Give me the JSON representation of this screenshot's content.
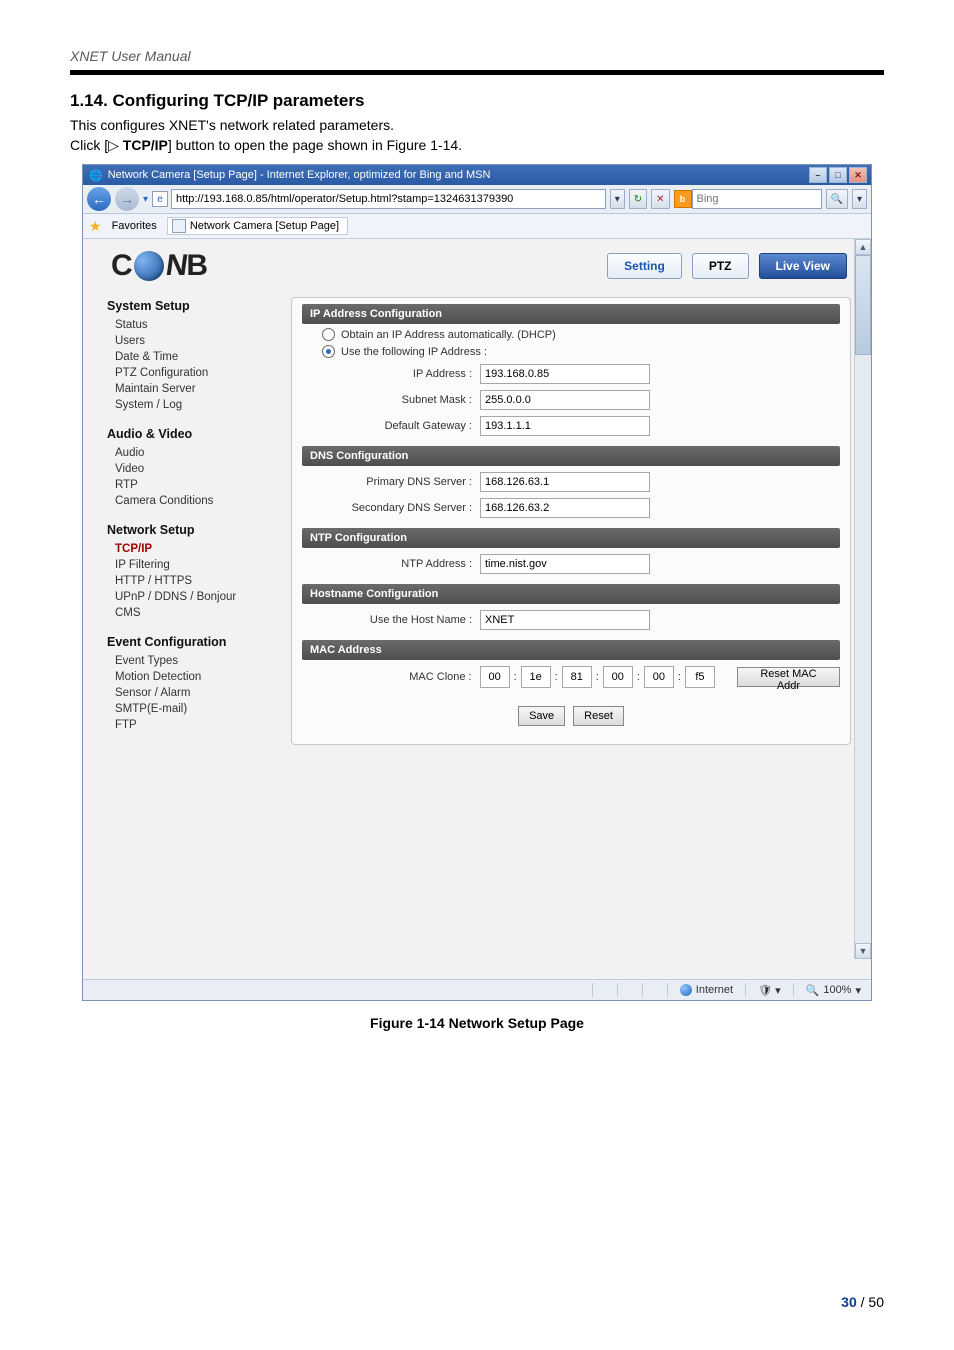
{
  "doc": {
    "running_head": "XNET User Manual",
    "section_title": "1.14. Configuring TCP/IP parameters",
    "body1": "This configures XNET's network related parameters.",
    "body2_pre": "Click [",
    "body2_symbol": "▷ ",
    "body2_btn": "TCP/IP",
    "body2_post": "] button to open the page shown in Figure 1-14.",
    "figure_caption": "Figure 1-14 Network Setup Page",
    "page_cur": "30",
    "page_sep": " / ",
    "page_total": "50"
  },
  "window": {
    "title": "Network Camera [Setup Page] - Internet Explorer, optimized for Bing and MSN",
    "addr": "http://193.168.0.85/html/operator/Setup.html?stamp=1324631379390",
    "search_placeholder": "Bing",
    "fav_label": "Favorites",
    "tab_title": "Network Camera [Setup Page]",
    "status_internet": "Internet",
    "status_zoom": "100%"
  },
  "header_buttons": {
    "setting": "Setting",
    "ptz": "PTZ",
    "live": "Live View"
  },
  "sidebar": {
    "g1": "System Setup",
    "g1_items": [
      "Status",
      "Users",
      "Date & Time",
      "PTZ Configuration",
      "Maintain Server",
      "System / Log"
    ],
    "g2": "Audio & Video",
    "g2_items": [
      "Audio",
      "Video",
      "RTP",
      "Camera Conditions"
    ],
    "g3": "Network Setup",
    "g3_items": [
      "TCP/IP",
      "IP Filtering",
      "HTTP / HTTPS",
      "UPnP / DDNS / Bonjour",
      "CMS"
    ],
    "g4": "Event Configuration",
    "g4_items": [
      "Event Types",
      "Motion Detection",
      "Sensor / Alarm",
      "SMTP(E-mail)",
      "FTP"
    ]
  },
  "panel": {
    "ip_cfg_title": "IP Address Configuration",
    "radio_dhcp": "Obtain an IP Address automatically. (DHCP)",
    "radio_static": "Use the following IP Address :",
    "ip_label": "IP Address :",
    "ip_value": "193.168.0.85",
    "mask_label": "Subnet Mask :",
    "mask_value": "255.0.0.0",
    "gw_label": "Default Gateway :",
    "gw_value": "193.1.1.1",
    "dns_title": "DNS Configuration",
    "pdns_label": "Primary DNS Server :",
    "pdns_value": "168.126.63.1",
    "sdns_label": "Secondary DNS Server :",
    "sdns_value": "168.126.63.2",
    "ntp_title": "NTP Configuration",
    "ntp_label": "NTP Address :",
    "ntp_value": "time.nist.gov",
    "host_title": "Hostname Configuration",
    "host_label": "Use the Host Name :",
    "host_value": "XNET",
    "mac_title": "MAC Address",
    "mac_label": "MAC Clone :",
    "mac": [
      "00",
      "1e",
      "81",
      "00",
      "00",
      "f5"
    ],
    "mac_reset": "Reset MAC Addr",
    "save": "Save",
    "reset": "Reset"
  }
}
